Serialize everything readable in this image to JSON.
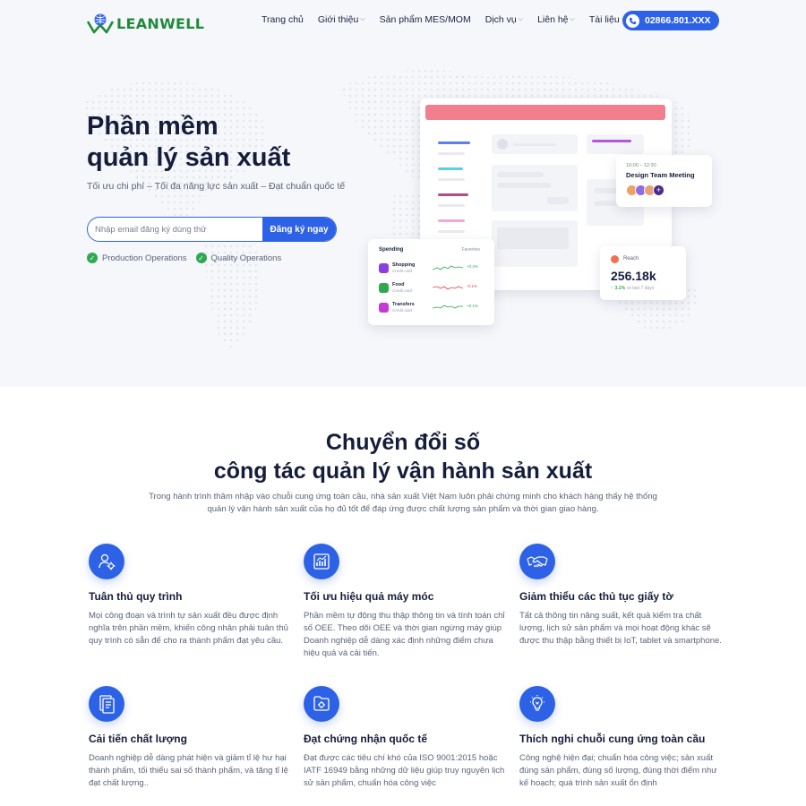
{
  "header": {
    "logo_text": "LEANWELL",
    "nav": [
      {
        "label": "Trang chủ",
        "dropdown": false
      },
      {
        "label": "Giới thiệu",
        "dropdown": true
      },
      {
        "label": "Sản phẩm MES/MOM",
        "dropdown": false
      },
      {
        "label": "Dịch vụ",
        "dropdown": true
      },
      {
        "label": "Liên hệ",
        "dropdown": true
      },
      {
        "label": "Tài liệu",
        "dropdown": true
      }
    ],
    "phone": "02866.801.XXX"
  },
  "hero": {
    "title_line1": "Phần mềm",
    "title_line2": "quản lý sản xuất",
    "subtitle": "Tối ưu chi phí – Tối đa năng lực sản xuất – Đạt chuẩn quốc tế",
    "email_placeholder": "Nhập email đăng ký dùng thử",
    "signup_label": "Đăng ký ngay",
    "checks": [
      "Production Operations",
      "Quality Operations"
    ]
  },
  "mockup": {
    "spending": {
      "title": "Spending",
      "filter": "Favorites",
      "rows": [
        {
          "name": "Shopping",
          "sub": "Credit card",
          "change": "+0.2%",
          "color": "#8b3fe0"
        },
        {
          "name": "Food",
          "sub": "Credit card",
          "change": "-0.1%",
          "color": "#2fa84f"
        },
        {
          "name": "Transfers",
          "sub": "Credit card",
          "change": "+0.1%",
          "color": "#c43ad6"
        }
      ]
    },
    "meeting": {
      "time": "10:00 – 12:30",
      "title": "Design Team Meeting"
    },
    "reach": {
      "label": "Reach",
      "value": "256.18k",
      "delta": "3.1%",
      "delta_note": "vs last 7 days"
    }
  },
  "section": {
    "title_line1": "Chuyển đổi số",
    "title_line2": "công tác quản lý vận hành sản xuất",
    "desc": "Trong hành trình thâm nhập vào chuỗi cung ứng toàn cầu, nhà sản xuất Việt Nam luôn phải chứng minh cho khách hàng thấy hệ thống quản lý vận hành sản xuất của họ đủ tốt để đáp ứng được chất lượng sản phẩm và thời gian giao hàng."
  },
  "features": [
    {
      "icon": "process-icon",
      "title": "Tuân thủ quy trình",
      "desc": "Mọi công đoạn và trình tự sản xuất đều được định nghĩa trên phần mềm, khiến công nhân phải tuân thủ quy trình có sẵn để cho ra thành phẩm đạt yêu cầu."
    },
    {
      "icon": "chart-icon",
      "title": "Tối ưu hiệu quả máy móc",
      "desc": "Phần mềm tự động thu thập thông tin và tính toán chỉ số OEE. Theo dõi OEE và thời gian ngừng máy giúp Doanh nghiệp dễ dàng xác định những điểm chưa hiệu quả và cải tiến."
    },
    {
      "icon": "handshake-icon",
      "title": "Giảm thiểu các thủ tục giấy tờ",
      "desc": "Tất cả thông tin năng suất, kết quả kiểm tra chất lượng, lịch sử sản phẩm và mọi hoạt động khác sẽ được thu thập bằng thiết bị IoT, tablet và smartphone."
    },
    {
      "icon": "document-icon",
      "title": "Cải tiến chất lượng",
      "desc": "Doanh nghiệp dễ dàng phát hiện và giảm tỉ lệ hư hại thành phẩm, tối thiểu sai số thành phẩm, và tăng tỉ lệ đạt chất lượng.."
    },
    {
      "icon": "certificate-icon",
      "title": "Đạt chứng nhận quốc tế",
      "desc": "Đạt được các tiêu chí khó của ISO 9001:2015 hoặc IATF 16949 bằng những dữ liệu giúp truy nguyên lịch sử sản phẩm, chuẩn hóa công việc"
    },
    {
      "icon": "lightbulb-icon",
      "title": "Thích nghi chuỗi cung ứng toàn cầu",
      "desc": "Công nghệ hiện đại; chuẩn hóa công việc; sản xuất đúng sản phẩm, đúng số lượng, đúng thời điểm như kế hoạch; quá trình sản xuất ổn định"
    }
  ]
}
